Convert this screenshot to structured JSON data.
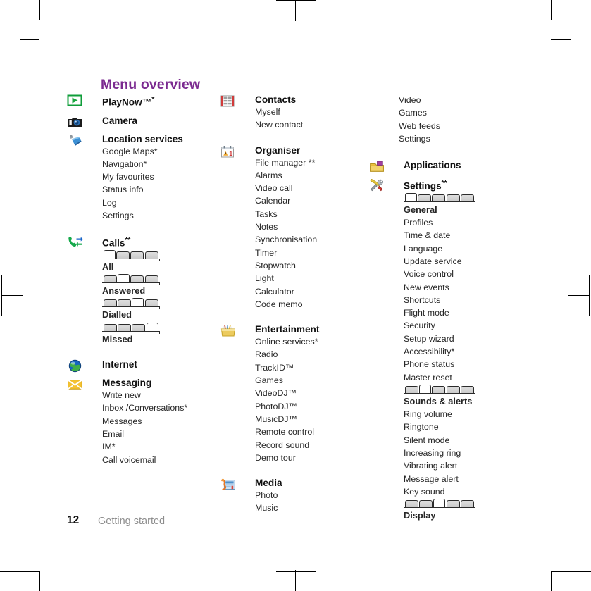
{
  "document": {
    "title": "Menu overview",
    "title_color": "#7b2a90",
    "page_number": "12",
    "footer_label": "Getting started",
    "footer_color": "#8d8d8d"
  },
  "columns": [
    {
      "id": "column-1",
      "groups": [
        {
          "icon": "playnow-icon",
          "title": "PlayNow™",
          "sup": "*",
          "items": []
        },
        {
          "icon": "camera-icon",
          "title": "Camera",
          "sup": "",
          "items": []
        },
        {
          "icon": "location-icon",
          "title": "Location services",
          "sup": "",
          "items": [
            "Google Maps*",
            "Navigation*",
            "My favourites",
            "Status info",
            "Log",
            "Settings"
          ]
        },
        {
          "icon": "calls-icon",
          "title": "Calls",
          "sup": "**",
          "tabgroups": [
            {
              "label": "All",
              "tabs": 4,
              "selected": 0
            },
            {
              "label": "Answered",
              "tabs": 4,
              "selected": 1
            },
            {
              "label": "Dialled",
              "tabs": 4,
              "selected": 2
            },
            {
              "label": "Missed",
              "tabs": 4,
              "selected": 3
            }
          ],
          "items": []
        },
        {
          "icon": "internet-icon",
          "title": "Internet",
          "sup": "",
          "items": []
        },
        {
          "icon": "messaging-icon",
          "title": "Messaging",
          "sup": "",
          "items": [
            "Write new",
            "Inbox /Conversations*",
            "Messages",
            "Email",
            "IM*",
            "Call voicemail"
          ]
        }
      ]
    },
    {
      "id": "column-2",
      "groups": [
        {
          "icon": "contacts-icon",
          "title": "Contacts",
          "sup": "",
          "items": [
            "Myself",
            "New contact"
          ]
        },
        {
          "icon": "organiser-icon",
          "title": "Organiser",
          "sup": "",
          "items": [
            "File manager **",
            "Alarms",
            "Video call",
            "Calendar",
            "Tasks",
            "Notes",
            "Synchronisation",
            "Timer",
            "Stopwatch",
            "Light",
            "Calculator",
            "Code memo"
          ]
        },
        {
          "icon": "entertainment-icon",
          "title": "Entertainment",
          "sup": "",
          "items": [
            "Online services*",
            "Radio",
            "TrackID™",
            "Games",
            "VideoDJ™",
            "PhotoDJ™",
            "MusicDJ™",
            "Remote control",
            "Record sound",
            "Demo tour"
          ]
        },
        {
          "icon": "media-icon",
          "title": "Media",
          "sup": "",
          "items": [
            "Photo",
            "Music"
          ]
        }
      ]
    },
    {
      "id": "column-3",
      "continuation": [
        "Video",
        "Games",
        "Web feeds",
        "Settings"
      ],
      "groups": [
        {
          "icon": "applications-icon",
          "title": "Applications",
          "sup": "",
          "items": []
        },
        {
          "icon": "settings-icon",
          "title": "Settings",
          "sup": "**",
          "sections": [
            {
              "tabs": 5,
              "selected": 0,
              "heading": "General",
              "items": [
                "Profiles",
                "Time & date",
                "Language",
                "Update service",
                "Voice control",
                "New events",
                "Shortcuts",
                "Flight mode",
                "Security",
                "Setup wizard",
                "Accessibility*",
                "Phone status",
                "Master reset"
              ]
            },
            {
              "tabs": 5,
              "selected": 1,
              "heading": "Sounds & alerts",
              "items": [
                "Ring volume",
                "Ringtone",
                "Silent mode",
                "Increasing ring",
                "Vibrating alert",
                "Message alert",
                "Key sound"
              ]
            },
            {
              "tabs": 5,
              "selected": 2,
              "heading": "Display",
              "items": []
            }
          ],
          "items": []
        }
      ]
    }
  ]
}
